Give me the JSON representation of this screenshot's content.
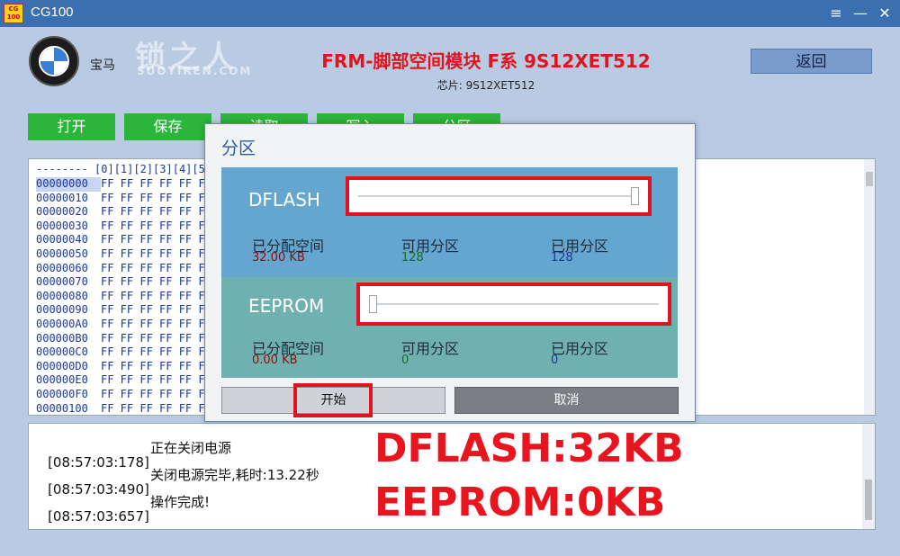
{
  "window": {
    "app_icon_text": "CG\n100",
    "title": "CG100",
    "menu_glyph": "≡",
    "minimize_glyph": "—",
    "close_glyph": "✕"
  },
  "header": {
    "brand_name": "宝马",
    "watermark_cn": "锁之人",
    "watermark_en": "SUOYIREN.COM",
    "module_title": "FRM-脚部空间模块 F系 9S12XET512",
    "chip_label": "芯片: 9S12XET512",
    "back_label": "返回"
  },
  "toolbar": {
    "buttons": [
      "打开",
      "保存",
      "读取",
      "写入",
      "分区"
    ]
  },
  "hex": {
    "header": "-------- [0][1][2][3][4][5",
    "addresses": [
      "00000000",
      "00000010",
      "00000020",
      "00000030",
      "00000040",
      "00000050",
      "00000060",
      "00000070",
      "00000080",
      "00000090",
      "000000A0",
      "000000B0",
      "000000C0",
      "000000D0",
      "000000E0",
      "000000F0",
      "00000100"
    ],
    "row_bytes": "FF FF FF FF FF F"
  },
  "log": {
    "lines": [
      {
        "time": "[08:57:03:178]",
        "msg": "正在关闭电源"
      },
      {
        "time": "[08:57:03:490]",
        "msg": "关闭电源完毕,耗时:13.22秒"
      },
      {
        "time": "[08:57:03:657]",
        "msg": "操作完成!"
      }
    ],
    "overlay_line1": "DFLASH:32KB",
    "overlay_line2": "EEPROM:0KB"
  },
  "dialog": {
    "title": "分区",
    "dflash": {
      "label": "DFLASH",
      "slider_value": 1.0,
      "allocated_label": "已分配空间",
      "allocated_value": "32.00 KB",
      "available_label": "可用分区",
      "available_value": "128",
      "used_label": "已用分区",
      "used_value": "128"
    },
    "eeprom": {
      "label": "EEPROM",
      "slider_value": 0.0,
      "allocated_label": "已分配空间",
      "allocated_value": "0.00 KB",
      "available_label": "可用分区",
      "available_value": "0",
      "used_label": "已用分区",
      "used_value": "0"
    },
    "start_label": "开始",
    "cancel_label": "取消"
  },
  "colors": {
    "titlebar": "#3a6fb0",
    "toolbar_green": "#2bb53a",
    "highlight_red": "#e0141e",
    "dflash_bg": "#64a6cf",
    "eeprom_bg": "#6fb1b1"
  }
}
